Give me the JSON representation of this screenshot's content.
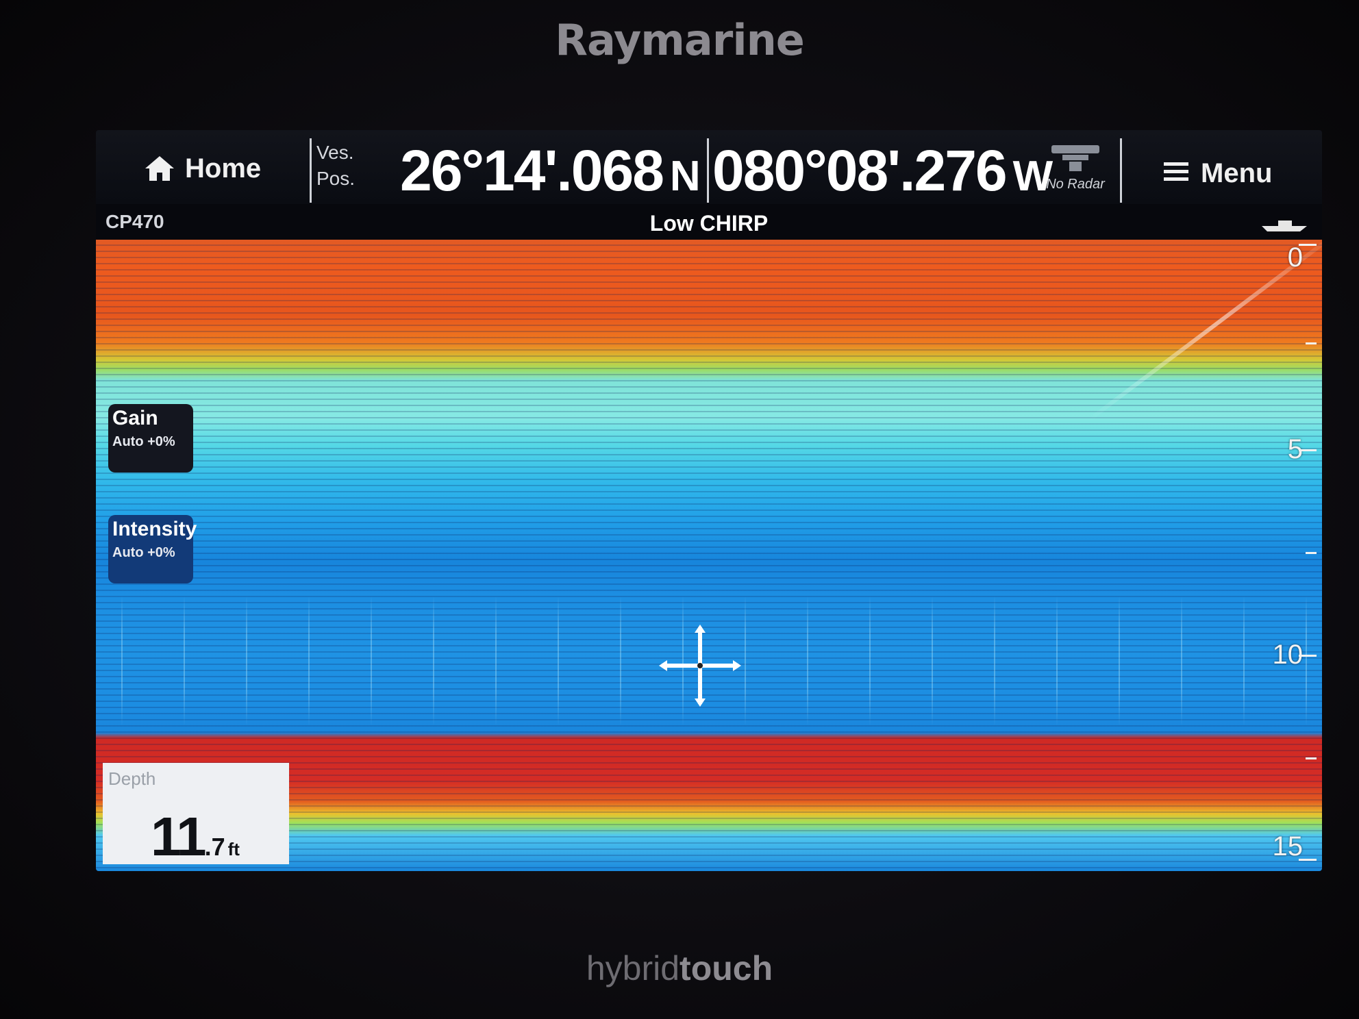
{
  "device": {
    "brand": "Raymarine",
    "model_prefix": "hybrid",
    "model_suffix": "touch"
  },
  "topbar": {
    "home_label": "Home",
    "ves_label": "Ves.",
    "pos_label": "Pos.",
    "latitude": "26°14'.068",
    "lat_hemisphere": "N",
    "longitude": "080°08'.276",
    "lon_hemisphere": "W",
    "radar_status": "No Radar",
    "menu_label": "Menu"
  },
  "subbar": {
    "transducer": "CP470",
    "mode": "Low CHIRP"
  },
  "controls": {
    "gain_label": "Gain",
    "gain_value": "Auto +0%",
    "intensity_label": "Intensity",
    "intensity_value": "Auto +0%"
  },
  "depth": {
    "label": "Depth",
    "value_int": "11",
    "value_dec": ".7",
    "unit": "ft"
  },
  "depth_scale": {
    "ticks": [
      "0",
      "5",
      "10",
      "15"
    ]
  },
  "colors": {
    "surface_return": "#ee5b1e",
    "water_column": "#1f93e4",
    "bottom_return": "#d42c25",
    "intensity_panel": "#123a78"
  }
}
